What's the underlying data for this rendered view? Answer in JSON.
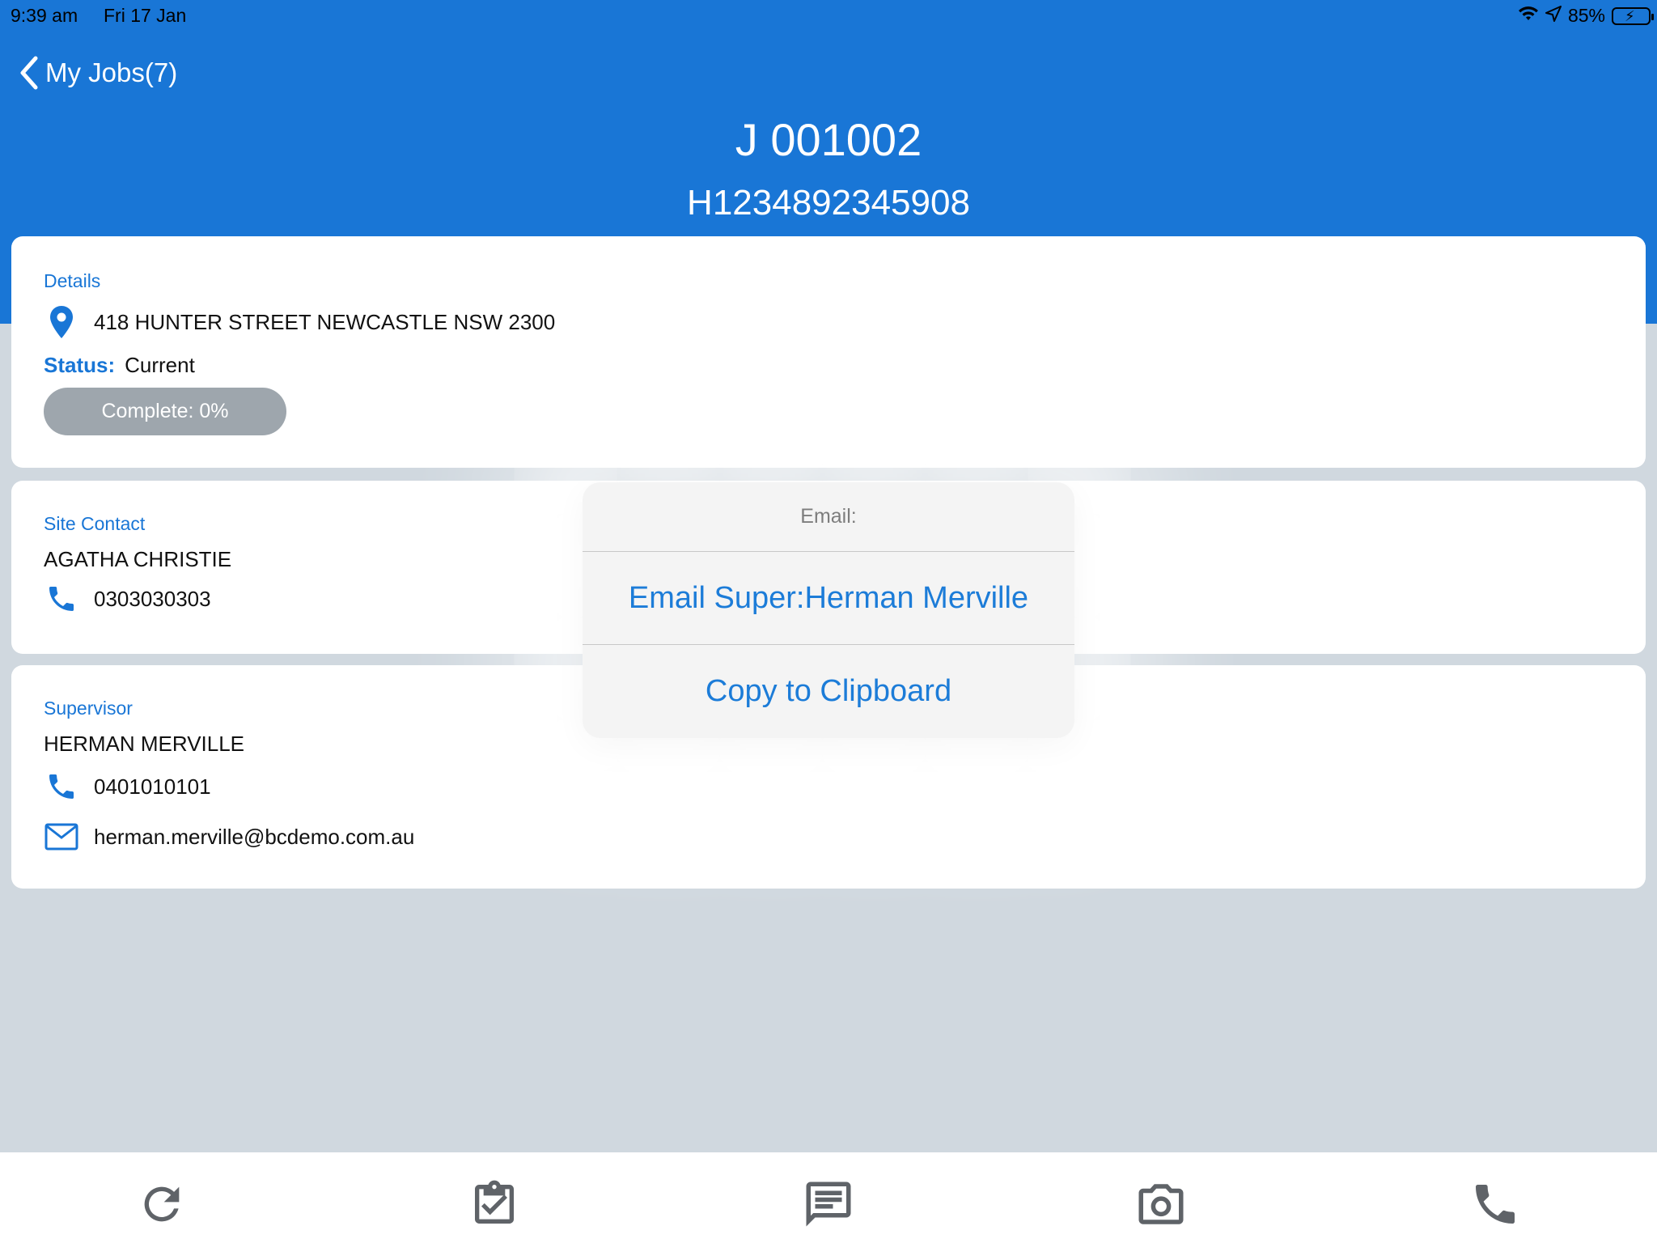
{
  "status_bar": {
    "time": "9:39 am",
    "date": "Fri 17 Jan",
    "battery": "85%"
  },
  "nav": {
    "back_label": "My Jobs(7)",
    "title": "J 001002",
    "subtitle": "H1234892345908"
  },
  "details": {
    "section_label": "Details",
    "address": "418 HUNTER STREET NEWCASTLE NSW 2300",
    "status_key": "Status:",
    "status_value": "Current",
    "progress_label": "Complete: 0%"
  },
  "site_contact": {
    "section_label": "Site Contact",
    "name": "AGATHA CHRISTIE",
    "phone": "0303030303"
  },
  "supervisor": {
    "section_label": "Supervisor",
    "name": "HERMAN MERVILLE",
    "phone": "0401010101",
    "email": "herman.merville@bcdemo.com.au"
  },
  "popover": {
    "title": "Email:",
    "option_email": "Email Super:Herman Merville",
    "option_copy": "Copy to Clipboard"
  },
  "colors": {
    "primary": "#1976d6",
    "background": "#d0d8df",
    "icon_gray": "#5f6368"
  },
  "tabbar": {
    "icons": [
      "refresh-icon",
      "clipboard-check-icon",
      "message-icon",
      "camera-icon",
      "phone-icon"
    ]
  }
}
